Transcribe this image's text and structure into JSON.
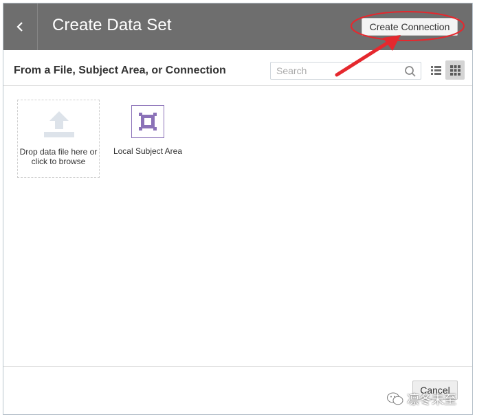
{
  "header": {
    "title": "Create Data Set",
    "create_connection_label": "Create Connection"
  },
  "toolbar": {
    "section_title": "From a File, Subject Area, or Connection",
    "search_placeholder": "Search",
    "search_value": ""
  },
  "tiles": [
    {
      "label": "Drop data file here or click to browse",
      "icon": "upload-icon"
    },
    {
      "label": "Local Subject Area",
      "icon": "subject-area-icon"
    }
  ],
  "footer": {
    "cancel_label": "Cancel"
  },
  "watermark": {
    "text": "凛冬未至"
  },
  "colors": {
    "header_bg": "#6e6e6e",
    "annotation_red": "#e5282e",
    "subject_area_purple": "#8b72b8"
  }
}
